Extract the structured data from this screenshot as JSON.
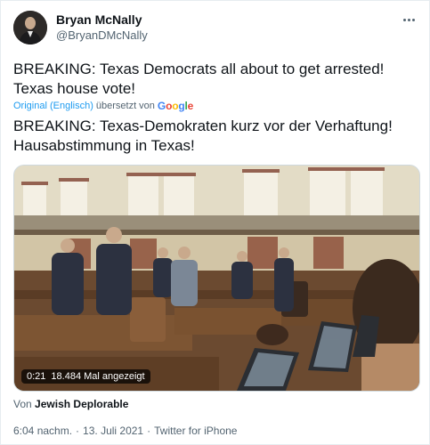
{
  "author": {
    "name": "Bryan McNally",
    "handle": "@BryanDMcNally"
  },
  "menu_icon": "more-horizontal-icon",
  "tweet": {
    "text_line1": "BREAKING: Texas Democrats all about to get arrested!",
    "text_line2": "Texas house vote!",
    "translate_original": "Original (Englisch)",
    "translate_by": "übersetzt von",
    "translate_provider": "Google",
    "translated_line1": "BREAKING: Texas-Demokraten kurz vor der Verhaftung!",
    "translated_line2": "Hausabstimmung in Texas!"
  },
  "video": {
    "duration": "0:21",
    "views": "18.484 Mal angezeigt"
  },
  "source": {
    "prefix": "Von",
    "name": "Jewish Deplorable"
  },
  "meta": {
    "time": "6:04 nachm.",
    "sep1": "·",
    "date": "13. Juli 2021",
    "sep2": "·",
    "client": "Twitter for iPhone"
  },
  "colors": {
    "link": "#1d9bf0",
    "text": "#0f1419",
    "secondary": "#536471"
  }
}
